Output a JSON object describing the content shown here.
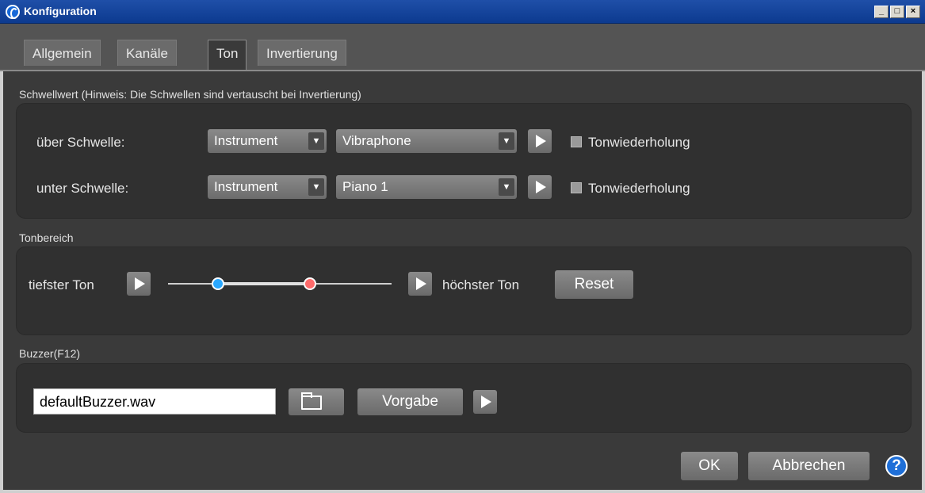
{
  "window": {
    "title": "Konfiguration",
    "controls": {
      "minimize": "_",
      "maximize": "□",
      "close": "×"
    }
  },
  "tabs": [
    {
      "label": "Allgemein",
      "active": false
    },
    {
      "label": "Kanäle",
      "active": false
    },
    {
      "label": "Ton",
      "active": true
    },
    {
      "label": "Invertierung",
      "active": false
    }
  ],
  "threshold": {
    "section_label": "Schwellwert  (Hinweis: Die Schwellen sind vertauscht bei Invertierung)",
    "above": {
      "label": "über Schwelle:",
      "type_value": "Instrument",
      "instrument_value": "Vibraphone",
      "repeat_label": "Tonwiederholung",
      "repeat_checked": false
    },
    "below": {
      "label": "unter Schwelle:",
      "type_value": "Instrument",
      "instrument_value": "Piano 1",
      "repeat_label": "Tonwiederholung",
      "repeat_checked": false
    }
  },
  "tone_range": {
    "section_label": "Tonbereich",
    "lowest_label": "tiefster Ton",
    "highest_label": "höchster Ton",
    "reset_label": "Reset",
    "low_color": "#2aa8ff",
    "high_color": "#ff6b6b"
  },
  "buzzer": {
    "section_label": "Buzzer(F12)",
    "file_value": "defaultBuzzer.wav",
    "default_label": "Vorgabe"
  },
  "footer": {
    "ok_label": "OK",
    "cancel_label": "Abbrechen",
    "help_label": "?"
  },
  "colors": {
    "background": "#3a3a3a",
    "panel": "#303030",
    "title_bar": "#0c3a8f",
    "help": "#1e6fd8"
  }
}
